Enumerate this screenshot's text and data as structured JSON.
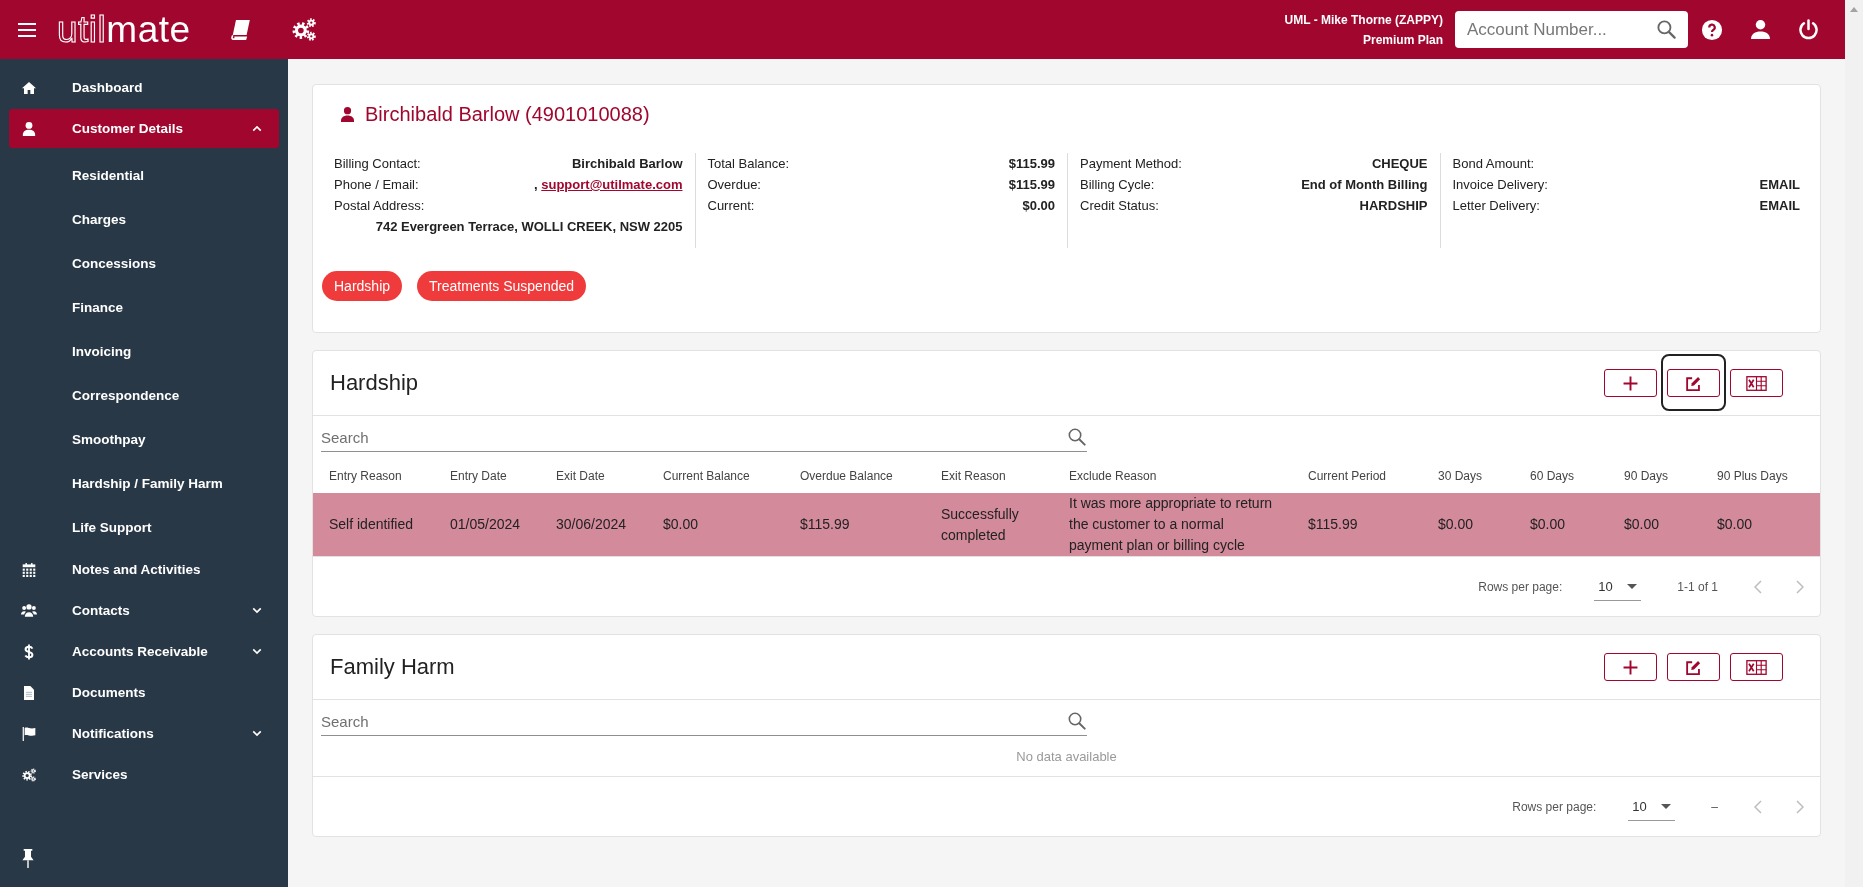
{
  "top_bar": {
    "logo": {
      "outlined": "util",
      "solid": "mate"
    },
    "user": "UML - Mike Thorne (ZAPPY)",
    "plan": "Premium Plan",
    "search": {
      "placeholder": "Account Number..."
    }
  },
  "sidebar": {
    "items": [
      {
        "label": "Dashboard",
        "kind": "link",
        "selected": false
      },
      {
        "label": "Customer Details",
        "kind": "group",
        "selected": true,
        "expanded": true,
        "children": [
          {
            "label": "Residential",
            "selected": false
          },
          {
            "label": "Charges",
            "selected": false
          },
          {
            "label": "Concessions",
            "selected": false
          },
          {
            "label": "Finance",
            "selected": false
          },
          {
            "label": "Invoicing",
            "selected": false
          },
          {
            "label": "Correspondence",
            "selected": false
          },
          {
            "label": "Smoothpay",
            "selected": false
          },
          {
            "label": "Hardship / Family Harm",
            "selected": false
          },
          {
            "label": "Life Support",
            "selected": false
          }
        ]
      },
      {
        "label": "Notes and Activities",
        "kind": "link",
        "selected": false
      },
      {
        "label": "Contacts",
        "kind": "group",
        "selected": false,
        "expanded": false
      },
      {
        "label": "Accounts Receivable",
        "kind": "group",
        "selected": false,
        "expanded": false
      },
      {
        "label": "Documents",
        "kind": "link",
        "selected": false
      },
      {
        "label": "Notifications",
        "kind": "group",
        "selected": false,
        "expanded": false
      },
      {
        "label": "Services",
        "kind": "link",
        "selected": false
      }
    ]
  },
  "customer": {
    "name": "Birchibald Barlow (4901010088)",
    "info_columns": [
      [
        {
          "kind": "text",
          "label": "Billing Contact:",
          "value": "Birchibald Barlow"
        },
        {
          "kind": "link",
          "label": "Phone / Email:",
          "prefix": ",",
          "link": "support@utilmate.com"
        },
        {
          "kind": "block",
          "label": "Postal Address:",
          "value": "742 Evergreen Terrace, WOLLI CREEK, NSW 2205"
        }
      ],
      [
        {
          "kind": "text",
          "label": "Total Balance:",
          "value": "$115.99"
        },
        {
          "kind": "text",
          "label": "Overdue:",
          "value": "$115.99"
        },
        {
          "kind": "text",
          "label": "Current:",
          "value": "$0.00"
        }
      ],
      [
        {
          "kind": "text",
          "label": "Payment Method:",
          "value": "CHEQUE"
        },
        {
          "kind": "text",
          "label": "Billing Cycle:",
          "value": "End of Month Billing"
        },
        {
          "kind": "text",
          "label": "Credit Status:",
          "value": "HARDSHIP"
        }
      ],
      [
        {
          "kind": "text",
          "label": "Bond Amount:"
        },
        {
          "kind": "text",
          "label": "Invoice Delivery:",
          "value": "EMAIL"
        },
        {
          "kind": "text",
          "label": "Letter Delivery:",
          "value": "EMAIL"
        }
      ]
    ],
    "tags": [
      "Hardship",
      "Treatments Suspended"
    ]
  },
  "sections": [
    {
      "title": "Hardship",
      "buttons": [
        {
          "kind": "add",
          "focused": false
        },
        {
          "kind": "edit",
          "focused": true
        },
        {
          "kind": "export",
          "focused": false
        }
      ],
      "search": {
        "placeholder": "Search"
      },
      "table": {
        "columns": [
          "Entry Reason",
          "Entry Date",
          "Exit Date",
          "Current Balance",
          "Overdue Balance",
          "Exit Reason",
          "Exclude Reason",
          "Current Period",
          "30 Days",
          "60 Days",
          "90 Days",
          "90 Plus Days"
        ],
        "rows": [
          {
            "selected": true,
            "cells": [
              "Self identified",
              "01/05/2024",
              "30/06/2024",
              "$0.00",
              "$115.99",
              "Successfully completed",
              "It was more appropriate to return the customer to a normal payment plan or billing cycle",
              "$115.99",
              "$0.00",
              "$0.00",
              "$0.00",
              "$0.00"
            ]
          }
        ]
      },
      "footer": {
        "rows_label": "Rows per page:",
        "rows_value": "10",
        "range": "1-1 of 1",
        "prev_disabled": true,
        "next_disabled": true
      }
    },
    {
      "title": "Family Harm",
      "buttons": [
        {
          "kind": "add",
          "focused": false
        },
        {
          "kind": "edit",
          "focused": false
        },
        {
          "kind": "export",
          "focused": false
        }
      ],
      "search": {
        "placeholder": "Search"
      },
      "empty_text": "No data available",
      "footer": {
        "rows_label": "Rows per page:",
        "rows_value": "10",
        "range": "–",
        "prev_disabled": true,
        "next_disabled": true
      }
    }
  ]
}
